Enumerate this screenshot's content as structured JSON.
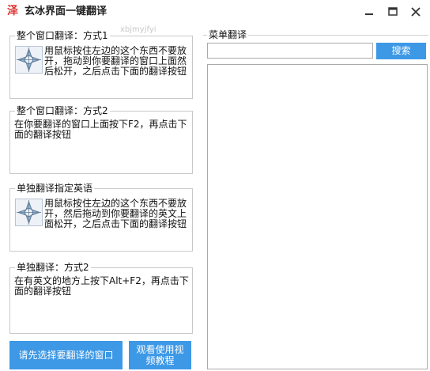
{
  "window": {
    "title": "玄冰界面一键翻译",
    "app_icon_glyph": "泽",
    "ghost_text": "xbjmyjfyi",
    "controls": [
      "minimize-icon",
      "maximize-icon",
      "close-icon"
    ]
  },
  "groups": [
    {
      "title": "整个窗口翻译：方式1",
      "text": "用鼠标按住左边的这个东西不要放开，拖动到你要翻译的窗口上面然后松开，之后点击下面的翻译按钮",
      "icon": "crosshair-drag-icon"
    },
    {
      "title": "整个窗口翻译：方式2",
      "text": "在你要翻译的窗口上面按下F2，再点击下面的翻译按钮"
    },
    {
      "title": "单独翻译指定英语",
      "text": "用鼠标按住左边的这个东西不要放开，然后拖动到你要翻译的英文上面松开，之后点击下面的翻译按钮",
      "icon": "crosshair-drag-icon"
    },
    {
      "title": "单独翻译：方式2",
      "text": "在有英文的地方上按下Alt+F2，再点击下面的翻译按钮"
    }
  ],
  "buttons": {
    "select_window": "请先选择要翻译的窗口",
    "tutorial": "观看使用视频教程"
  },
  "menu_translate": {
    "title": "菜单翻译",
    "search_value": "",
    "search_button": "搜索",
    "results": []
  },
  "colors": {
    "accent_blue": "#3d98e6",
    "icon_red": "#e0342f",
    "border": "#c9c9c9"
  }
}
